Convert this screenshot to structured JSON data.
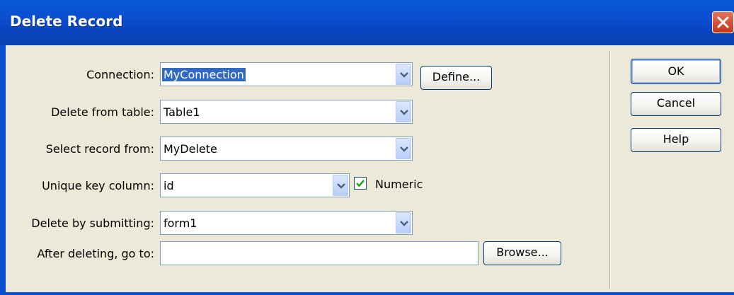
{
  "window": {
    "title": "Delete Record"
  },
  "fields": {
    "connection": {
      "label": "Connection:",
      "value": "MyConnection"
    },
    "delete_from_table": {
      "label": "Delete from table:",
      "value": "Table1"
    },
    "select_record_from": {
      "label": "Select record from:",
      "value": "MyDelete"
    },
    "unique_key_column": {
      "label": "Unique key column:",
      "value": "id"
    },
    "numeric": {
      "label": "Numeric",
      "checked": true
    },
    "delete_by_submitting": {
      "label": "Delete by submitting:",
      "value": "form1"
    },
    "after_deleting": {
      "label": "After deleting, go to:",
      "value": ""
    }
  },
  "buttons": {
    "define": "Define...",
    "browse": "Browse...",
    "ok": "OK",
    "cancel": "Cancel",
    "help": "Help"
  },
  "colors": {
    "titlebar": "#0b4fd0",
    "dialog_bg": "#ece9d8",
    "selection": "#316ac5",
    "close_button": "#c2351a"
  }
}
